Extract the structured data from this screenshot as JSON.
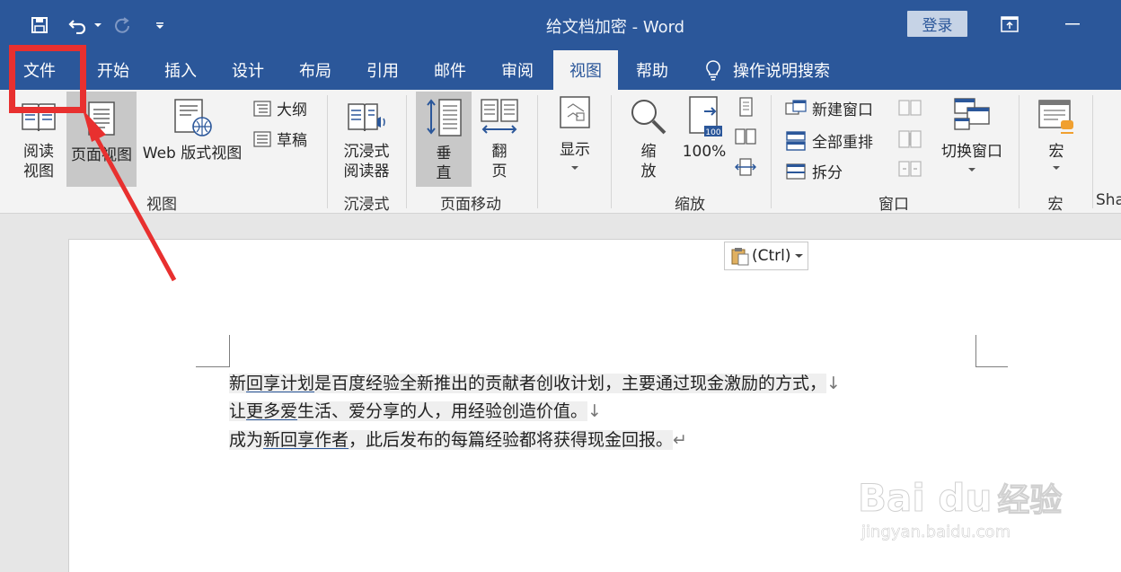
{
  "title_bar": {
    "doc_title": "给文档加密  -  Word",
    "login_label": "登录"
  },
  "tabs": [
    {
      "label": "文件"
    },
    {
      "label": "开始"
    },
    {
      "label": "插入"
    },
    {
      "label": "设计"
    },
    {
      "label": "布局"
    },
    {
      "label": "引用"
    },
    {
      "label": "邮件"
    },
    {
      "label": "审阅"
    },
    {
      "label": "视图",
      "active": true
    },
    {
      "label": "帮助"
    }
  ],
  "tell_me": {
    "label": "操作说明搜索",
    "icon": "lightbulb-icon"
  },
  "ribbon": {
    "views": {
      "read_line1": "阅读",
      "read_line2": "视图",
      "print_layout": "页面视图",
      "web_layout": "Web 版式视图",
      "outline": "大纲",
      "draft": "草稿",
      "group": "视图"
    },
    "immersive": {
      "reader_line1": "沉浸式",
      "reader_line2": "阅读器",
      "group": "沉浸式"
    },
    "page_movement": {
      "vertical_line1": "垂",
      "vertical_line2": "直",
      "side_line1": "翻",
      "side_line2": "页",
      "group": "页面移动"
    },
    "show": {
      "label": "显示"
    },
    "zoom": {
      "zoom_line1": "缩",
      "zoom_line2": "放",
      "hundred": "100%",
      "hundred_badge": "100",
      "group": "缩放"
    },
    "window": {
      "new_window": "新建窗口",
      "arrange_all": "全部重排",
      "split": "拆分",
      "switch_windows": "切换窗口",
      "group": "窗口"
    },
    "macros": {
      "label": "宏",
      "group": "宏",
      "cut": "Sha"
    }
  },
  "document": {
    "line1": {
      "a": "新",
      "b": "回享计划",
      "c": "是百度经验全新推出的贡献者创收计划，主要通过现金激励的方式，",
      "mark": "↓"
    },
    "line2": {
      "a": "让",
      "b": "更多爱",
      "c": "生活、爱分享的人，用经验创造价值。",
      "mark": "↓"
    },
    "line3": {
      "a": "成为",
      "b": "新回享作者",
      "c": "，此后发布的每篇经验都将获得现金回报。",
      "mark": "↵"
    },
    "paste_label": "(Ctrl)"
  },
  "watermark": {
    "brand": "Bai du",
    "cn": "经验",
    "url": "jingyan.baidu.com"
  },
  "colors": {
    "accent": "#2b579a",
    "highlight_red": "#e8302f"
  }
}
